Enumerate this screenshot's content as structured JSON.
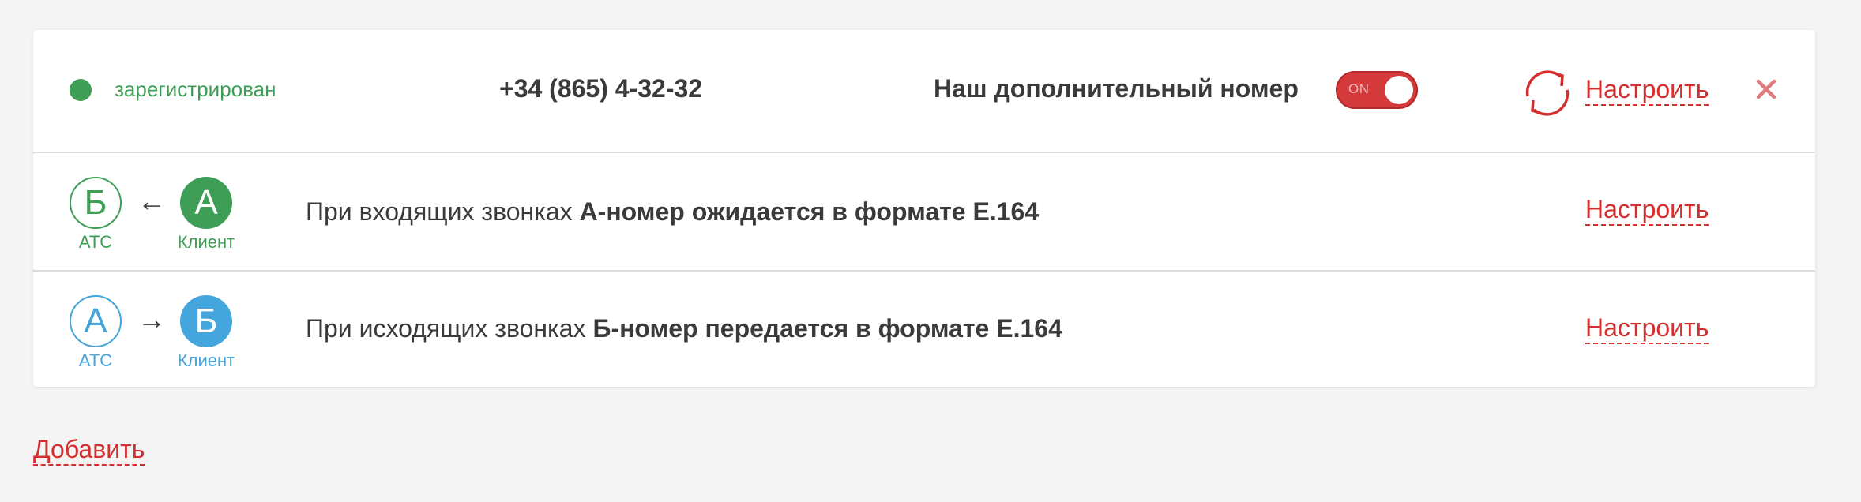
{
  "number_card": {
    "status": "зарегистрирован",
    "phone": "+34 (865) 4-32-32",
    "name": "Наш дополнительный номер",
    "toggle_label": "ON",
    "configure_label": "Настроить"
  },
  "incoming": {
    "left_letter": "Б",
    "left_caption": "АТС",
    "arrow": "←",
    "right_letter": "А",
    "right_caption": "Клиент",
    "text_prefix": "При входящих звонках ",
    "text_bold": "А-номер ожидается в формате E.164",
    "configure_label": "Настроить"
  },
  "outgoing": {
    "left_letter": "А",
    "left_caption": "АТС",
    "arrow": "→",
    "right_letter": "Б",
    "right_caption": "Клиент",
    "text_prefix": "При исходящих звонках ",
    "text_bold": "Б-номер передается в формате E.164",
    "configure_label": "Настроить"
  },
  "add_label": "Добавить",
  "icons": {
    "status": "status-dot",
    "refresh": "refresh-icon",
    "close": "close-icon"
  },
  "colors": {
    "accent_red": "#d32f2f",
    "green": "#3f9e56",
    "blue": "#45a6dd",
    "toggle_on": "#d53a3a"
  }
}
